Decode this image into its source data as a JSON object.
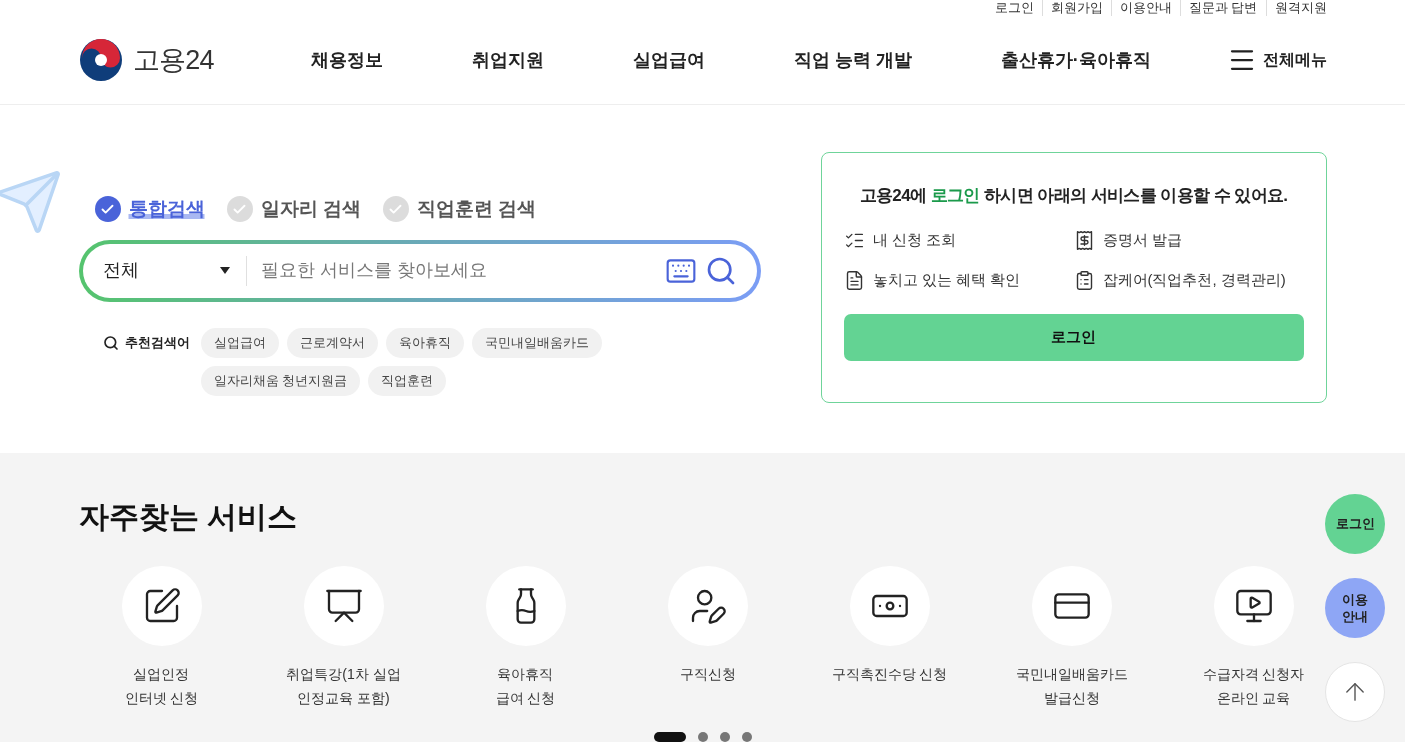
{
  "top_links": [
    "로그인",
    "회원가입",
    "이용안내",
    "질문과 답변",
    "원격지원"
  ],
  "logo": {
    "text": "고용24"
  },
  "nav": [
    "채용정보",
    "취업지원",
    "실업급여",
    "직업 능력 개발",
    "출산휴가·육아휴직"
  ],
  "all_menu": {
    "label": "전체메뉴"
  },
  "search": {
    "tabs": [
      {
        "label": "통합검색",
        "selected": true
      },
      {
        "label": "일자리 검색",
        "selected": false
      },
      {
        "label": "직업훈련 검색",
        "selected": false
      }
    ],
    "scope": "전체",
    "placeholder": "필요한 서비스를 찾아보세요",
    "recommended_label": "추천검색어",
    "keywords": [
      "실업급여",
      "근로계약서",
      "육아휴직",
      "국민내일배움카드",
      "일자리채움 청년지원금",
      "직업훈련"
    ]
  },
  "login_card": {
    "title": {
      "before": "고용24에 ",
      "highlight": "로그인",
      "after": " 하시면 아래의 서비스를 이용할 수 있어요."
    },
    "services": [
      "내 신청 조회",
      "증명서 발급",
      "놓치고 있는 혜택 확인",
      "잡케어(직업추천, 경력관리)"
    ],
    "button": "로그인"
  },
  "frequent_services": {
    "title": "자주찾는 서비스",
    "items": [
      {
        "lines": [
          "실업인정",
          "인터넷 신청"
        ]
      },
      {
        "lines": [
          "취업특강(1차 실업",
          "인정교육 포함)"
        ]
      },
      {
        "lines": [
          "육아휴직",
          "급여 신청"
        ]
      },
      {
        "lines": [
          "구직신청"
        ]
      },
      {
        "lines": [
          "구직촉진수당 신청"
        ]
      },
      {
        "lines": [
          "국민내일배움카드",
          "발급신청"
        ]
      },
      {
        "lines": [
          "수급자격 신청자",
          "온라인 교육"
        ]
      }
    ],
    "pager": [
      {
        "selected": true
      },
      {
        "selected": false
      },
      {
        "selected": false
      },
      {
        "selected": false
      }
    ]
  },
  "floating_buttons": [
    {
      "kind": "login",
      "lines": [
        "로그인"
      ]
    },
    {
      "kind": "guide",
      "lines": [
        "이용",
        "안내"
      ]
    },
    {
      "kind": "top"
    }
  ]
}
